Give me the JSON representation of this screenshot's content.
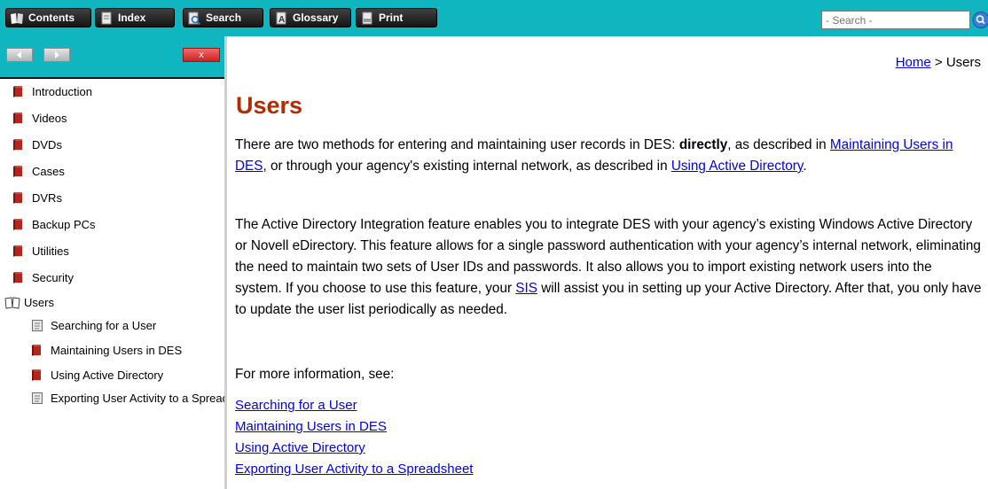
{
  "toolbar": {
    "buttons": [
      {
        "label": "Contents",
        "icon": "contents-icon"
      },
      {
        "label": "Index",
        "icon": "index-icon"
      },
      {
        "label": "Search",
        "icon": "search-icon"
      },
      {
        "label": "Glossary",
        "icon": "glossary-icon"
      },
      {
        "label": "Print",
        "icon": "print-icon"
      }
    ],
    "search_placeholder": "- Search -",
    "search_go_icon": "magnifier-icon"
  },
  "sidebar": {
    "close_label": "x",
    "items": [
      {
        "label": "Introduction",
        "icon": "closed-book-icon"
      },
      {
        "label": "Videos",
        "icon": "closed-book-icon"
      },
      {
        "label": "DVDs",
        "icon": "closed-book-icon"
      },
      {
        "label": "Cases",
        "icon": "closed-book-icon"
      },
      {
        "label": "DVRs",
        "icon": "closed-book-icon"
      },
      {
        "label": "Backup PCs",
        "icon": "closed-book-icon"
      },
      {
        "label": "Utilities",
        "icon": "closed-book-icon"
      },
      {
        "label": "Security",
        "icon": "closed-book-icon"
      },
      {
        "label": "Users",
        "icon": "open-book-icon"
      }
    ],
    "sub_items": [
      {
        "label": "Searching for a User",
        "icon": "page-icon"
      },
      {
        "label": "Maintaining Users in DES",
        "icon": "closed-book-icon"
      },
      {
        "label": "Using Active Directory",
        "icon": "closed-book-icon"
      },
      {
        "label": "Exporting User Activity to a Spreadsheet",
        "icon": "page-icon"
      }
    ]
  },
  "content": {
    "breadcrumb_home": "Home",
    "breadcrumb_sep": " > ",
    "breadcrumb_current": "Users",
    "title": "Users",
    "p1": {
      "t1": "There are two methods for entering and maintaining user records in DES: ",
      "bold": "directly",
      "t2": ", as described in ",
      "link1": "Maintaining Users in DES",
      "t3": ", or through your agency's existing internal network, as described in ",
      "link2": "Using Active Directory",
      "t4": "."
    },
    "p2": {
      "t1": "The Active Directory Integration feature enables you to integrate DES with your agency’s existing Windows Active Directory or Novell eDirectory. This feature allows for a single password authentication with your agency’s internal network, eliminating the need to maintain two sets of User IDs and passwords. It also allows you to import existing network users into the system. If you choose to use this feature, your ",
      "link": "SIS",
      "t2": " will assist you in setting up your Active Directory. After that, you only have to update the user list periodically as needed."
    },
    "p3": "For more information, see:",
    "links": [
      "Searching for a User",
      "Maintaining Users in DES",
      "Using Active Directory",
      "Exporting User Activity to a Spreadsheet"
    ]
  }
}
